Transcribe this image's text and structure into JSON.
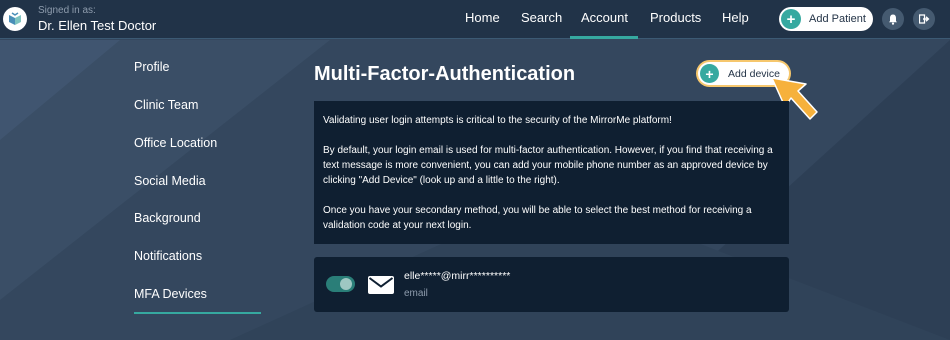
{
  "header": {
    "signed_in_label": "Signed in as:",
    "user_name": "Dr. Ellen Test Doctor",
    "nav": [
      {
        "label": "Home"
      },
      {
        "label": "Search"
      },
      {
        "label": "Account",
        "active": true
      },
      {
        "label": "Products"
      },
      {
        "label": "Help"
      }
    ],
    "add_patient_label": "Add Patient",
    "icons": [
      "bell-icon",
      "logout-icon"
    ]
  },
  "sidebar": {
    "items": [
      {
        "label": "Profile"
      },
      {
        "label": "Clinic Team"
      },
      {
        "label": "Office Location"
      },
      {
        "label": "Social Media"
      },
      {
        "label": "Background"
      },
      {
        "label": "Notifications"
      },
      {
        "label": "MFA Devices",
        "active": true
      }
    ]
  },
  "main": {
    "title": "Multi-Factor-Authentication",
    "add_device_label": "Add device",
    "info_paragraphs": [
      "Validating user login attempts is critical to the security of the MirrorMe platform!",
      "By default, your login email is used for multi-factor authentication. However, if you find that receiving a text message is more convenient, you can add your mobile phone number as an approved device by clicking \"Add Device\" (look up and a little to the right).",
      "Once you have your secondary method, you will be able to select the best method for receiving a validation code at your next login."
    ],
    "device": {
      "enabled": true,
      "value": "elle*****@mirr**********",
      "type": "email"
    }
  },
  "colors": {
    "background": "#34475e",
    "topbar": "#213348",
    "panel": "#0f1f31",
    "accent": "#36a9a0",
    "pointer": "#f6b13c"
  }
}
